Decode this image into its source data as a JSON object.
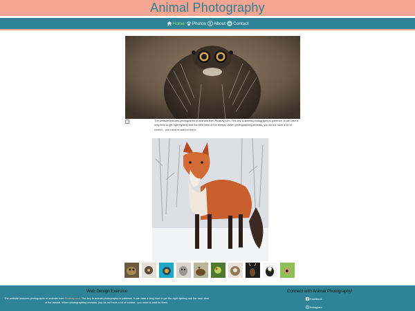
{
  "header": {
    "title": "Animal Photography"
  },
  "nav": {
    "items": [
      {
        "label": "Home",
        "icon": "home-icon"
      },
      {
        "label": "Photos",
        "icon": "paw-icon"
      },
      {
        "label": "About",
        "icon": "person-icon"
      },
      {
        "label": "Contact",
        "icon": "mail-icon"
      }
    ]
  },
  "main": {
    "description": "The website features photographs of animals from Pixabay.com. The key to animal photography is patience. It can take a long time to get right lighting and the best view of the animal. When photographing animals, you do not have a lot of control... you need to wait for them."
  },
  "footer": {
    "title": "Web Design Exercise",
    "text_before": "The website features photographs of animals from ",
    "link": "Pixabay.com",
    "text_after": ". The key to animal photography is patience. It can take a long time to get the right lighting and the best view of the animal. When photographing animals, you do not have a lot of control.. you need to wait for them.",
    "connect_title": "Connect with Animal Photography!",
    "social": {
      "facebook": "Facebook",
      "instagram": "Instagram"
    }
  },
  "colors": {
    "accent_salmon": "#f4a593",
    "accent_teal": "#2e8496",
    "active_nav": "#9be36b"
  }
}
